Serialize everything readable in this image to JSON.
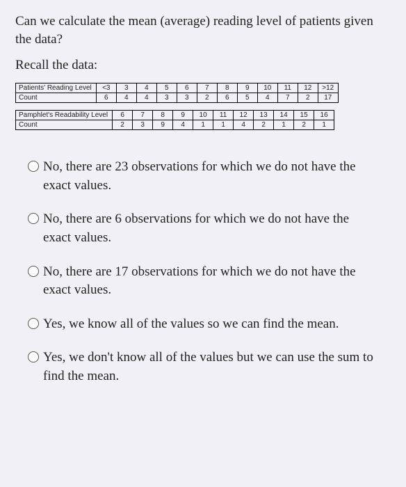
{
  "question": "Can we calculate the mean (average) reading level of patients given the data?",
  "recall": "Recall the data:",
  "table1": {
    "row1_label": "Patients' Reading Level",
    "row1": [
      "<3",
      "3",
      "4",
      "5",
      "6",
      "7",
      "8",
      "9",
      "10",
      "11",
      "12",
      ">12"
    ],
    "row2_label": "Count",
    "row2": [
      "6",
      "4",
      "4",
      "3",
      "3",
      "2",
      "6",
      "5",
      "4",
      "7",
      "2",
      "17"
    ]
  },
  "table2": {
    "row1_label": "Pamphlet's Readability Level",
    "row1": [
      "6",
      "7",
      "8",
      "9",
      "10",
      "11",
      "12",
      "13",
      "14",
      "15",
      "16"
    ],
    "row2_label": "Count",
    "row2": [
      "2",
      "3",
      "9",
      "4",
      "1",
      "1",
      "4",
      "2",
      "1",
      "2",
      "1"
    ]
  },
  "options": [
    "No, there are 23 observations for which we do not have the exact values.",
    "No, there are 6 observations for which we do not have the exact values.",
    "No, there are 17 observations for which we do not have the exact values.",
    "Yes, we know all of the values so we can find the mean.",
    "Yes, we don't know all of the values but we can use the sum to find the mean."
  ],
  "chart_data": [
    {
      "type": "table",
      "title": "Patients' Reading Level",
      "categories": [
        "<3",
        "3",
        "4",
        "5",
        "6",
        "7",
        "8",
        "9",
        "10",
        "11",
        "12",
        ">12"
      ],
      "values": [
        6,
        4,
        4,
        3,
        3,
        2,
        6,
        5,
        4,
        7,
        2,
        17
      ]
    },
    {
      "type": "table",
      "title": "Pamphlet's Readability Level",
      "categories": [
        "6",
        "7",
        "8",
        "9",
        "10",
        "11",
        "12",
        "13",
        "14",
        "15",
        "16"
      ],
      "values": [
        2,
        3,
        9,
        4,
        1,
        1,
        4,
        2,
        1,
        2,
        1
      ]
    }
  ]
}
